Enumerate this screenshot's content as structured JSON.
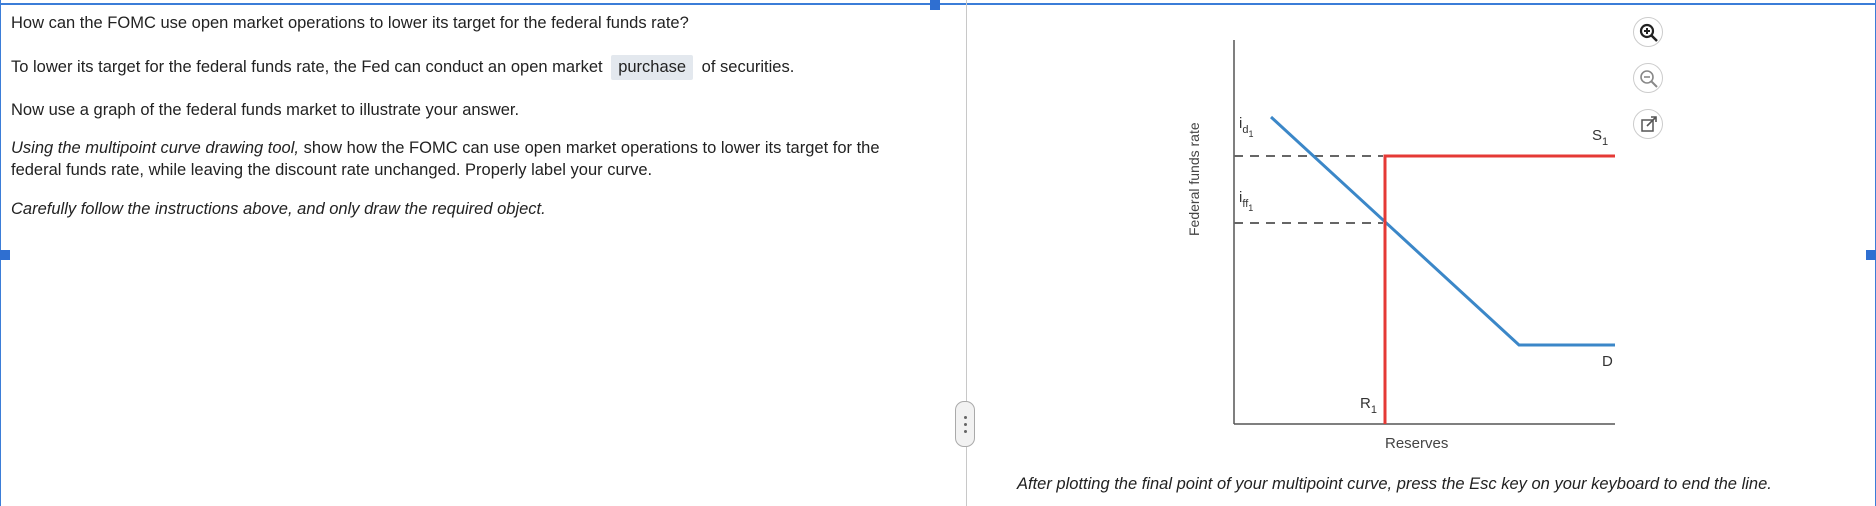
{
  "question": {
    "prompt": "How can the FOMC use open market operations to lower its target for the federal funds rate?",
    "answer_before": "To lower its target for the federal funds rate, the Fed can conduct an open market",
    "answer_choice": "purchase",
    "answer_after": "of securities.",
    "graph_instruction": "Now use a graph of the federal funds market to illustrate your answer.",
    "tool_instruction_italic": "Using the multipoint curve drawing tool,",
    "tool_instruction_rest": "show how the FOMC can use open market operations to lower its target for the federal funds rate, while leaving the discount rate unchanged. Properly label your curve.",
    "caution": "Carefully follow the instructions above, and only draw the required object."
  },
  "graph": {
    "y_axis_label": "Federal funds rate",
    "x_axis_label": "Reserves",
    "labels": {
      "id1_main": "i",
      "id1_sub": "d",
      "id1_subsub": "1",
      "iff1_main": "i",
      "iff1_sub": "ff",
      "iff1_subsub": "1",
      "s1_main": "S",
      "s1_sub": "1",
      "d_label": "D",
      "r1_main": "R",
      "r1_sub": "1"
    },
    "colors": {
      "supply": "#e53935",
      "demand": "#3b87c8",
      "axis": "#555555",
      "dashed": "#666666"
    }
  },
  "tools": {
    "zoom_in": "zoom-in-icon",
    "zoom_out": "zoom-out-icon",
    "popout": "external-link-icon"
  },
  "footer": {
    "note": "After plotting the final point of your multipoint curve, press the Esc key on your keyboard to end the line."
  }
}
